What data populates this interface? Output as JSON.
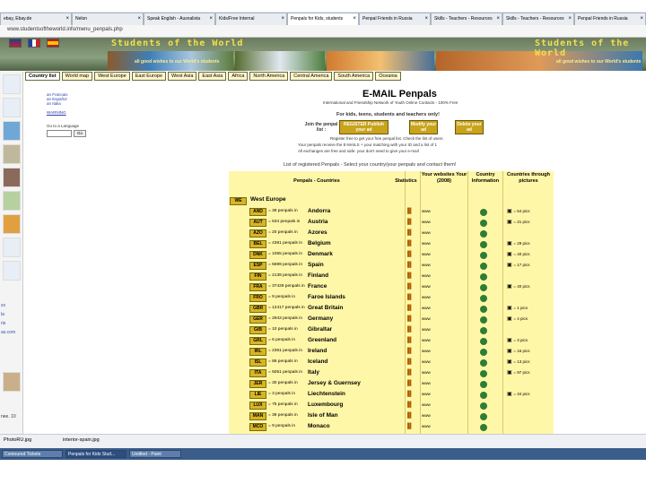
{
  "browser_tabs": [
    {
      "label": "ebay, Ebay.de"
    },
    {
      "label": "Nelon"
    },
    {
      "label": "Speak English - Ausnalista"
    },
    {
      "label": "Kids/Free Internal"
    },
    {
      "label": "Penpals for Kids, students"
    },
    {
      "label": "Penpal Friends in Russia"
    },
    {
      "label": "Skills - Teachers - Resources"
    },
    {
      "label": "Skills - Teachers - Resources"
    },
    {
      "label": "Penpal Friends in Russia"
    }
  ],
  "url": "www.studentsoftheworld.info/menu_penpals.php",
  "banner": {
    "title": "Students of the World",
    "subtitle": "all good wishes to our World's students"
  },
  "nav": [
    "Country list",
    "World map",
    "West Europe",
    "East Europe",
    "West Asia",
    "East Asia",
    "Africa",
    "North America",
    "Central America",
    "South America",
    "Oceania"
  ],
  "left_links": [
    "an Francais",
    "an Español",
    "an Italia"
  ],
  "left_warning": "WARNING",
  "left_side_label": "Go to a Language",
  "left_go": "Go",
  "left_bottom": [
    "xx",
    "la",
    "ris",
    "as.com",
    "nee. 10"
  ],
  "heading": "E-MAIL Penpals",
  "intro1": "International and Friendship Network of Youth Online Contacts - 100% Free",
  "intro2": "For kids, teens, students and teachers only!",
  "join_label": "Join the penpal list :",
  "buttons": {
    "register": "REGISTER Publish your ad",
    "modify": "Modify your ad",
    "delete": "Delete your ad"
  },
  "register_line": "Register free to get your free penpal list. Check the list of users",
  "info_line1": "Your penpals receive the E-MAILS + your matching with your ID and a list of 1",
  "info_line2": "All exchanges are free and safe: your don't need to give your e-mail",
  "list_caption": "List of registered Penpals - Select your country/your penpals and contact them!",
  "table_headers": {
    "countries": "Penpals - Countries",
    "stats": "Statistics",
    "websites": "Your websites Your (2008)",
    "info": "Country Information",
    "pictures": "Countries through pictures"
  },
  "region": {
    "code": "WE",
    "name": "West Europe"
  },
  "rows": [
    {
      "code": "AND",
      "count": "= 39 penpals in",
      "country": "Andorra",
      "pics": "= 54 pics"
    },
    {
      "code": "AUT",
      "count": "= 634 penpals in",
      "country": "Austria",
      "pics": "= 21 pics"
    },
    {
      "code": "AZO",
      "count": "= 20 penpals in",
      "country": "Azores",
      "pics": ""
    },
    {
      "code": "BEL",
      "count": "= 4381 penpals in",
      "country": "Belgium",
      "pics": "= 29 pics"
    },
    {
      "code": "DNK",
      "count": "= 1065 penpals in",
      "country": "Denmark",
      "pics": "= 40 pics"
    },
    {
      "code": "ESP",
      "count": "= 5699 penpals in",
      "country": "Spain",
      "pics": "= 17 pics"
    },
    {
      "code": "FIN",
      "count": "= 2139 penpals in",
      "country": "Finland",
      "pics": ""
    },
    {
      "code": "FRA",
      "count": "= 37429 penpals in",
      "country": "France",
      "pics": "= 40 pics"
    },
    {
      "code": "FRO",
      "count": "= 9 penpals in",
      "country": "Faroe Islands",
      "pics": ""
    },
    {
      "code": "GBR",
      "count": "= 12417 penpals in",
      "country": "Great Britain",
      "pics": "= 1 pics"
    },
    {
      "code": "GER",
      "count": "= 2943 penpals in",
      "country": "Germany",
      "pics": "= 4 pics"
    },
    {
      "code": "GIB",
      "count": "= 10 penpals in",
      "country": "Gibraltar",
      "pics": ""
    },
    {
      "code": "GRL",
      "count": "= 6 penpals in",
      "country": "Greenland",
      "pics": "= 3 pics"
    },
    {
      "code": "IRL",
      "count": "= 2361 penpals in",
      "country": "Ireland",
      "pics": "= 16 pics"
    },
    {
      "code": "ISL",
      "count": "= 86 penpals in",
      "country": "Iceland",
      "pics": "= 13 pics"
    },
    {
      "code": "ITA",
      "count": "= 5051 penpals in",
      "country": "Italy",
      "pics": "= 97 pics"
    },
    {
      "code": "JER",
      "count": "= 30 penpals in",
      "country": "Jersey & Guernsey",
      "pics": ""
    },
    {
      "code": "LIE",
      "count": "= 3 penpals in",
      "country": "Liechtenstein",
      "pics": "= 34 pics"
    },
    {
      "code": "LUX",
      "count": "= 75 penpals in",
      "country": "Luxembourg",
      "pics": ""
    },
    {
      "code": "MAN",
      "count": "= 39 penpals in",
      "country": "Isle of Man",
      "pics": ""
    },
    {
      "code": "MCO",
      "count": "= 9 penpals in",
      "country": "Monaco",
      "pics": ""
    }
  ],
  "downloads": [
    "PhotoRU.jpg",
    "interior-spain.jpg"
  ],
  "taskbar": [
    "Contoured Tickets",
    "Penpals for Kids Stud...",
    "Untitled - Paint"
  ]
}
